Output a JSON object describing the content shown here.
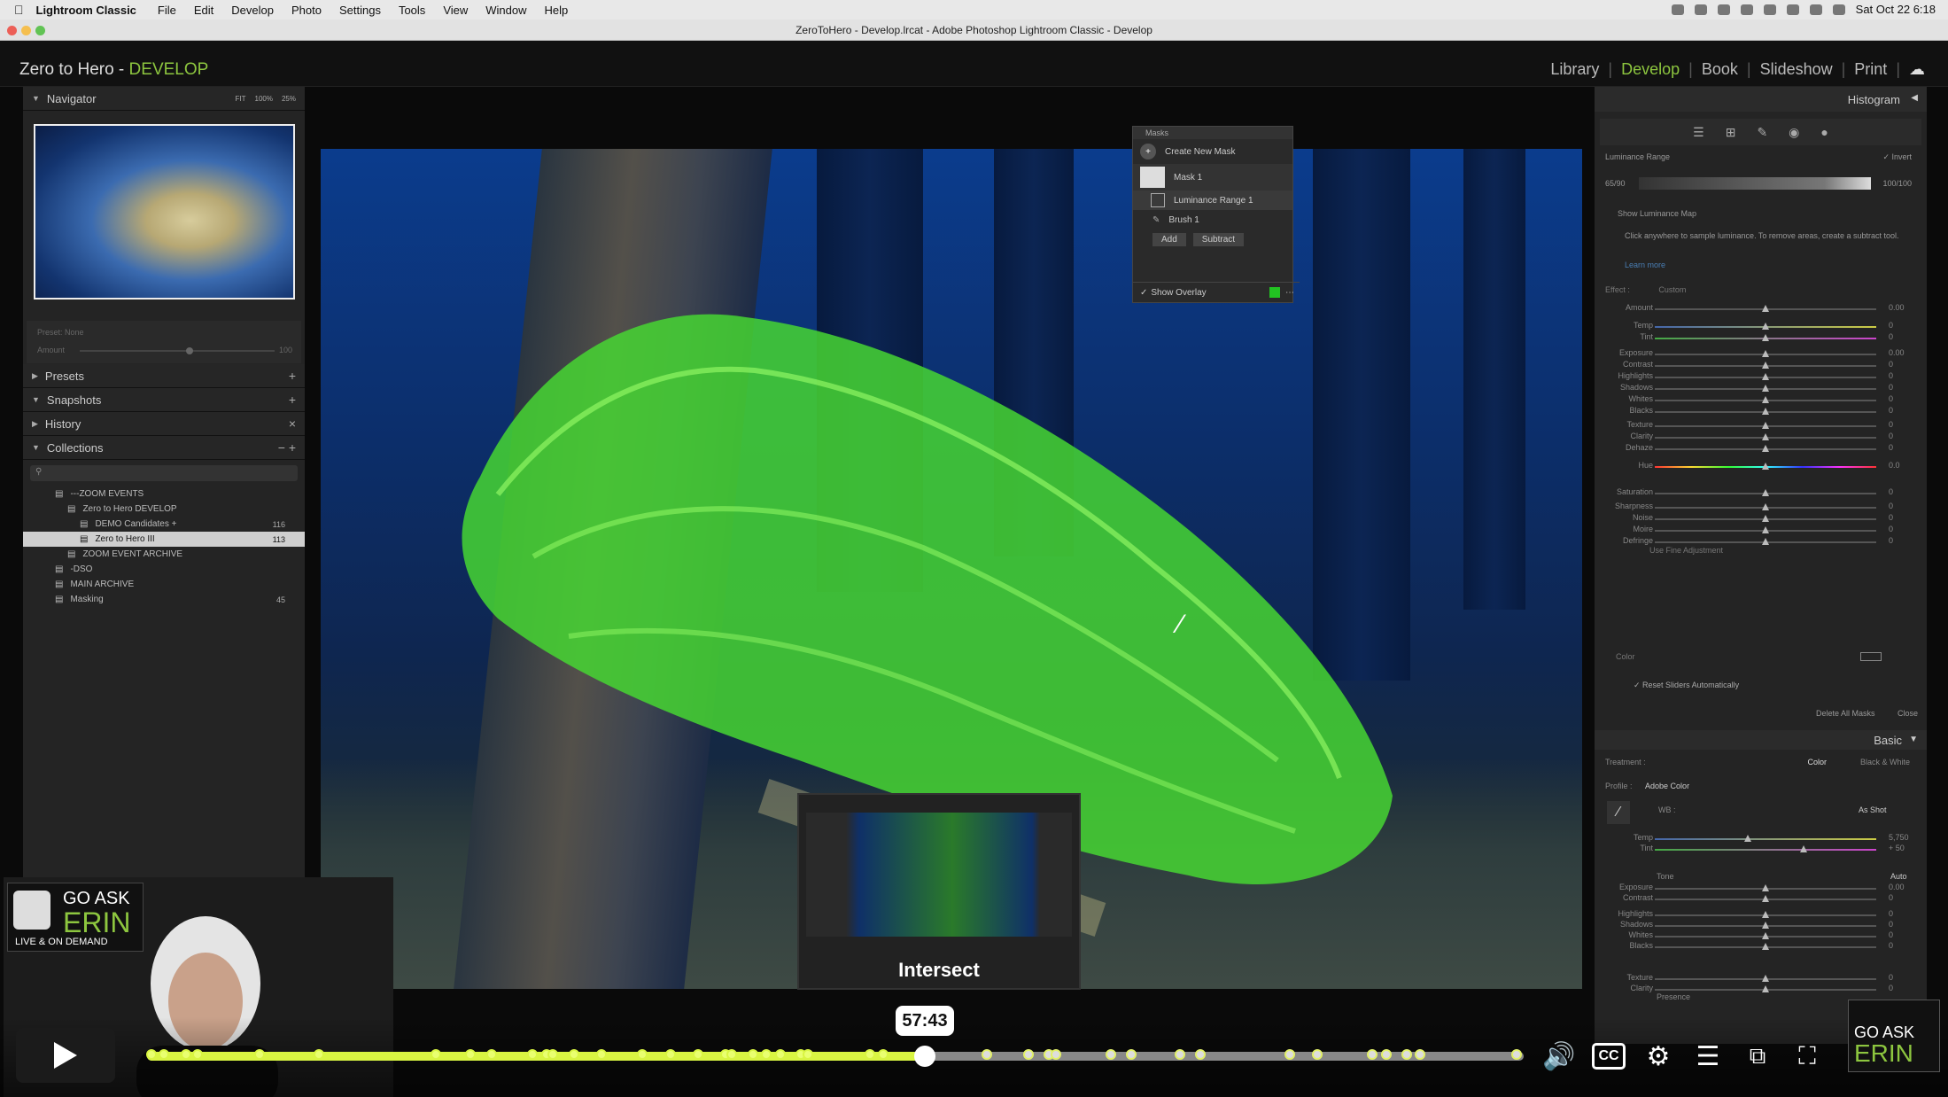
{
  "menubar": {
    "app": "Lightroom Classic",
    "items": [
      "File",
      "Edit",
      "Develop",
      "Photo",
      "Settings",
      "Tools",
      "View",
      "Window",
      "Help"
    ],
    "clock": "Sat Oct 22  6:18"
  },
  "window": {
    "title": "ZeroToHero - Develop.lrcat - Adobe Photoshop Lightroom Classic - Develop"
  },
  "identity": {
    "catalog": "Zero to Hero - ",
    "module": "DEVELOP"
  },
  "modules": [
    "Library",
    "Develop",
    "Book",
    "Slideshow",
    "Print"
  ],
  "left": {
    "navigator": {
      "title": "Navigator",
      "zooms": [
        "FIT",
        "100%",
        "25%"
      ]
    },
    "preset": {
      "label": "Preset:",
      "value": "None",
      "amount_label": "Amount",
      "amount_value": "100"
    },
    "presets": "Presets",
    "snapshots": "Snapshots",
    "history": "History",
    "collections": {
      "title": "Collections",
      "rows": [
        {
          "label": "---ZOOM EVENTS",
          "count": ""
        },
        {
          "label": "Zero to Hero DEVELOP",
          "count": ""
        },
        {
          "label": "DEMO Candidates +",
          "count": "116"
        },
        {
          "label": "Zero to Hero III",
          "count": "113"
        },
        {
          "label": "ZOOM EVENT ARCHIVE",
          "count": ""
        },
        {
          "label": "-DSO",
          "count": ""
        },
        {
          "label": "MAIN ARCHIVE",
          "count": ""
        },
        {
          "label": "Masking",
          "count": "45"
        }
      ]
    }
  },
  "masks_panel": {
    "title": "Masks",
    "create": "Create New Mask",
    "mask1": "Mask 1",
    "lum": "Luminance Range 1",
    "brush": "Brush 1",
    "add": "Add",
    "subtract": "Subtract",
    "overlay": "Show Overlay",
    "overlay_color": "#22c322"
  },
  "right": {
    "histogram": "Histogram",
    "lum_range": {
      "label": "Luminance Range",
      "invert": "Invert",
      "low": "65/90",
      "high": "100/100",
      "show_map": "Show Luminance Map",
      "hint": "Click anywhere to sample luminance. To remove areas, create a subtract tool.",
      "learn": "Learn more"
    },
    "effect": {
      "label": "Effect :",
      "preset": "Custom"
    },
    "sliders": [
      {
        "name": "Amount",
        "value": "0.00",
        "pos": 0.5
      },
      {
        "name": "Temp",
        "value": "0",
        "pos": 0.5
      },
      {
        "name": "Tint",
        "value": "0",
        "pos": 0.5
      },
      {
        "name": "Exposure",
        "value": "0.00",
        "pos": 0.5
      },
      {
        "name": "Contrast",
        "value": "0",
        "pos": 0.5
      },
      {
        "name": "Highlights",
        "value": "0",
        "pos": 0.5
      },
      {
        "name": "Shadows",
        "value": "0",
        "pos": 0.5
      },
      {
        "name": "Whites",
        "value": "0",
        "pos": 0.5
      },
      {
        "name": "Blacks",
        "value": "0",
        "pos": 0.5
      },
      {
        "name": "Texture",
        "value": "0",
        "pos": 0.5
      },
      {
        "name": "Clarity",
        "value": "0",
        "pos": 0.5
      },
      {
        "name": "Dehaze",
        "value": "0",
        "pos": 0.5
      },
      {
        "name": "Hue",
        "value": "0.0",
        "pos": 0.5
      },
      {
        "name": "Saturation",
        "value": "0",
        "pos": 0.5
      },
      {
        "name": "Sharpness",
        "value": "0",
        "pos": 0.5
      },
      {
        "name": "Noise",
        "value": "0",
        "pos": 0.5
      },
      {
        "name": "Moire",
        "value": "0",
        "pos": 0.5
      },
      {
        "name": "Defringe",
        "value": "0",
        "pos": 0.5
      }
    ],
    "fine": "Use Fine Adjustment",
    "color": "Color",
    "reset": "Reset Sliders Automatically",
    "delete_all": "Delete All Masks",
    "close": "Close",
    "basic": {
      "title": "Basic",
      "treatment": "Treatment :",
      "color": "Color",
      "bw": "Black & White",
      "profile_label": "Profile :",
      "profile": "Adobe Color",
      "wb": "WB :",
      "wb_value": "As Shot",
      "tone": "Tone",
      "auto": "Auto",
      "presence": "Presence",
      "sliders": [
        {
          "name": "Temp",
          "value": "5,750",
          "pos": 0.42
        },
        {
          "name": "Tint",
          "value": "+ 50",
          "pos": 0.67
        },
        {
          "name": "Exposure",
          "value": "0.00",
          "pos": 0.5
        },
        {
          "name": "Contrast",
          "value": "0",
          "pos": 0.5
        },
        {
          "name": "Highlights",
          "value": "0",
          "pos": 0.5
        },
        {
          "name": "Shadows",
          "value": "0",
          "pos": 0.5
        },
        {
          "name": "Whites",
          "value": "0",
          "pos": 0.5
        },
        {
          "name": "Blacks",
          "value": "0",
          "pos": 0.5
        },
        {
          "name": "Texture",
          "value": "0",
          "pos": 0.5
        },
        {
          "name": "Clarity",
          "value": "0",
          "pos": 0.5
        }
      ]
    }
  },
  "video": {
    "current_time": "57:43",
    "preview_label": "Intersect",
    "progress": 0.565,
    "chapters": [
      0.003,
      0.012,
      0.028,
      0.037,
      0.082,
      0.125,
      0.21,
      0.235,
      0.25,
      0.28,
      0.29,
      0.295,
      0.31,
      0.33,
      0.36,
      0.38,
      0.4,
      0.42,
      0.425,
      0.44,
      0.45,
      0.46,
      0.475,
      0.48,
      0.525,
      0.535,
      0.61,
      0.64,
      0.655,
      0.66,
      0.7,
      0.715,
      0.75,
      0.765,
      0.83,
      0.85,
      0.89,
      0.9,
      0.915,
      0.925,
      0.995
    ]
  },
  "logo": {
    "line1": "GO ASK",
    "line2": "ERIN",
    "tag": "LIVE & ON DEMAND"
  }
}
